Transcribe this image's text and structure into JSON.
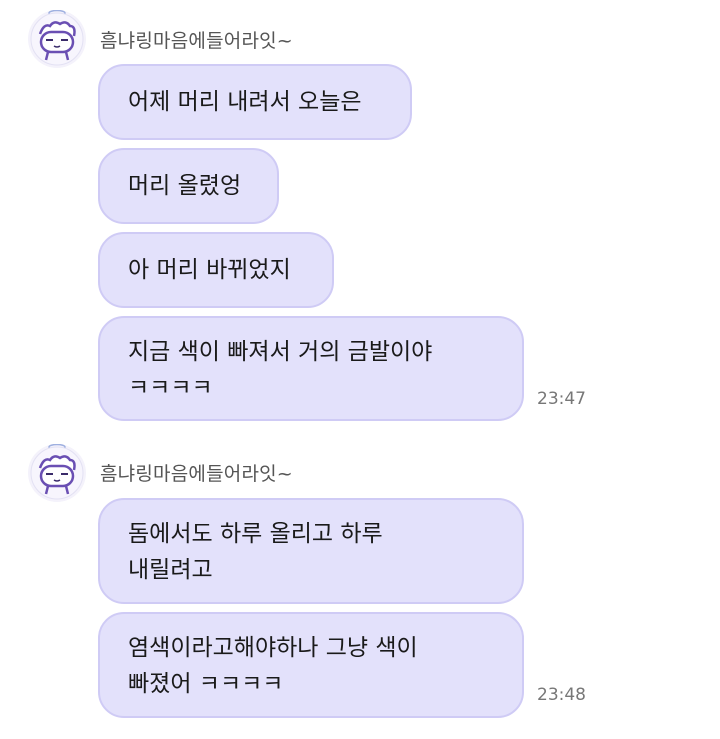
{
  "groups": [
    {
      "sender": "흠냐링마음에들어라잇~",
      "avatar_icon": "cartoon-cat-avatar-icon",
      "messages": [
        "어제 머리 내려서 오늘은",
        "머리 올렸엉",
        "아 머리 바뀌었지",
        "지금 색이 빠져서 거의 금발이야\nㅋㅋㅋㅋ"
      ],
      "time": "23:47"
    },
    {
      "sender": "흠냐링마음에들어라잇~",
      "avatar_icon": "cartoon-cat-avatar-icon",
      "messages": [
        "돔에서도 하루 올리고 하루\n내릴려고",
        "염색이라고해야하나 그냥 색이\n빠졌어 ㅋㅋㅋㅋ"
      ],
      "time": "23:48"
    }
  ],
  "colors": {
    "bubble_fill": "#e3e1fb",
    "bubble_border": "#cfcbf5",
    "avatar_accent": "#6a4fb3"
  }
}
